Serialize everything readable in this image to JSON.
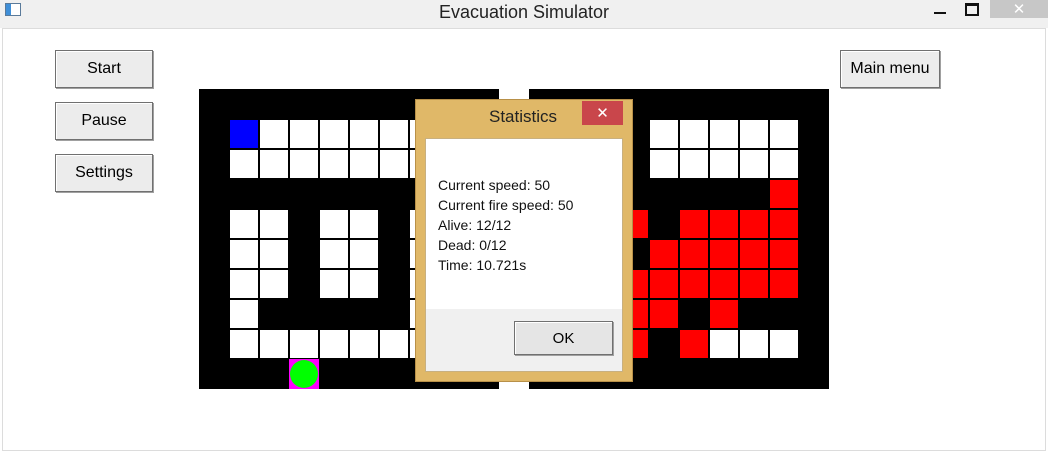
{
  "window": {
    "title": "Evacuation Simulator",
    "minimize_icon": "minimize-icon",
    "maximize_icon": "maximize-icon",
    "close_label": "✕"
  },
  "controls": {
    "start_label": "Start",
    "pause_label": "Pause",
    "settings_label": "Settings",
    "main_menu_label": "Main menu"
  },
  "dialog": {
    "title": "Statistics",
    "close_label": "✕",
    "lines": [
      "Current speed: 50",
      "Current fire speed: 50",
      "Alive: 12/12",
      "Dead: 0/12",
      "Time: 10.721s"
    ],
    "ok_label": "OK"
  },
  "colors": {
    "wall": "#000000",
    "floor": "#ffffff",
    "fire": "#ff0000",
    "person": "#0000ff",
    "agent": "#00ff00",
    "exit_marker": "#ff00ff",
    "dialog_frame": "#e0b868",
    "dialog_close": "#c9464b"
  },
  "maze": {
    "legend": [
      "wall",
      "floor",
      "fire",
      "person",
      "exit",
      "agent"
    ],
    "left_grid": [
      "..........",
      ".PWWWWWWW.",
      ".WWWWWWWW.",
      "..........",
      ".WW.WW.WW.",
      ".WW.WW.WW.",
      ".WW.WW.WW.",
      ".W.....WW.",
      ".WWWWWWWW.",
      "...E......"
    ],
    "right_grid": [
      "..........",
      "....WWWWW.",
      "....WWWWW.",
      "........F.",
      "...F.FFFF.",
      "....FFFFF.",
      "...FFFFFF.",
      "...FF.F...",
      "...F.FWWW.",
      ".........."
    ]
  }
}
